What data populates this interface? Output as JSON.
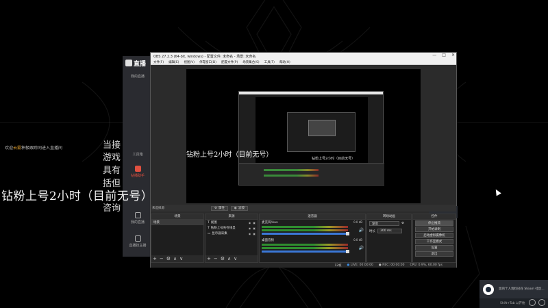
{
  "background": {
    "welcome_prefix": "欢迎",
    "welcome_highlight": "云雾",
    "welcome_suffix": "积极跟踪同进入直播间",
    "lines": [
      "当接",
      "游戏",
      "具有",
      "括但",
      "咨询"
    ],
    "overlay": "钻粉上号2小时（目前无号）"
  },
  "left_app": {
    "logo": "直播",
    "items": [
      {
        "label": "我的直播",
        "active": false
      },
      {
        "label": "",
        "active": false
      },
      {
        "label": "工具箱",
        "active": false
      },
      {
        "label": "钻播助手",
        "active": true
      },
      {
        "label": "我的直播",
        "active": false
      },
      {
        "label": "直播技主播",
        "active": false
      }
    ]
  },
  "obs": {
    "title": "OBS 27.2.3 (64-bit, windows) - 配置文件: 未命名 - 场景: 未命名",
    "window_buttons": [
      "—",
      "□",
      "✕"
    ],
    "menu": [
      "文件(F)",
      "编辑(E)",
      "视图(V)",
      "停靠窗口(D)",
      "配置文件(P)",
      "场景集合(S)",
      "工具(T)",
      "帮助(H)"
    ],
    "preview_overlay": "钻粉上号2小时（目前无号）",
    "toolbar": {
      "label": "未选择源",
      "props": "属性",
      "filters": "滤镜"
    },
    "docks": {
      "scenes": {
        "title": "场景",
        "items": [
          "场景"
        ]
      },
      "sources": {
        "title": "来源",
        "items": [
          "视图",
          "钻粉上号先在线显",
          "显示器采集"
        ]
      },
      "mixer": {
        "title": "混音器",
        "channels": [
          {
            "name": "麦克风/Aux",
            "db": "0.0 dB"
          },
          {
            "name": "桌面音频",
            "db": "0.0 dB"
          }
        ]
      },
      "transitions": {
        "title": "转场动画",
        "type": "渐变",
        "duration_label": "时长",
        "duration": "300 ms"
      },
      "controls": {
        "title": "控件",
        "buttons": [
          "停止推流",
          "开始录制",
          "启动虚拟摄像机",
          "工作室模式",
          "设置",
          "退出"
        ]
      }
    },
    "status": {
      "dropped": "12帧",
      "live": "LIVE: 00:00:00",
      "rec": "REC: 00:00:00",
      "cpu": "CPU: 0.9%, 60.00 fps"
    }
  },
  "steam": {
    "notice": "您的个人资料已在 Steam 社区...",
    "hint": "Shift+Tab 以开始"
  }
}
